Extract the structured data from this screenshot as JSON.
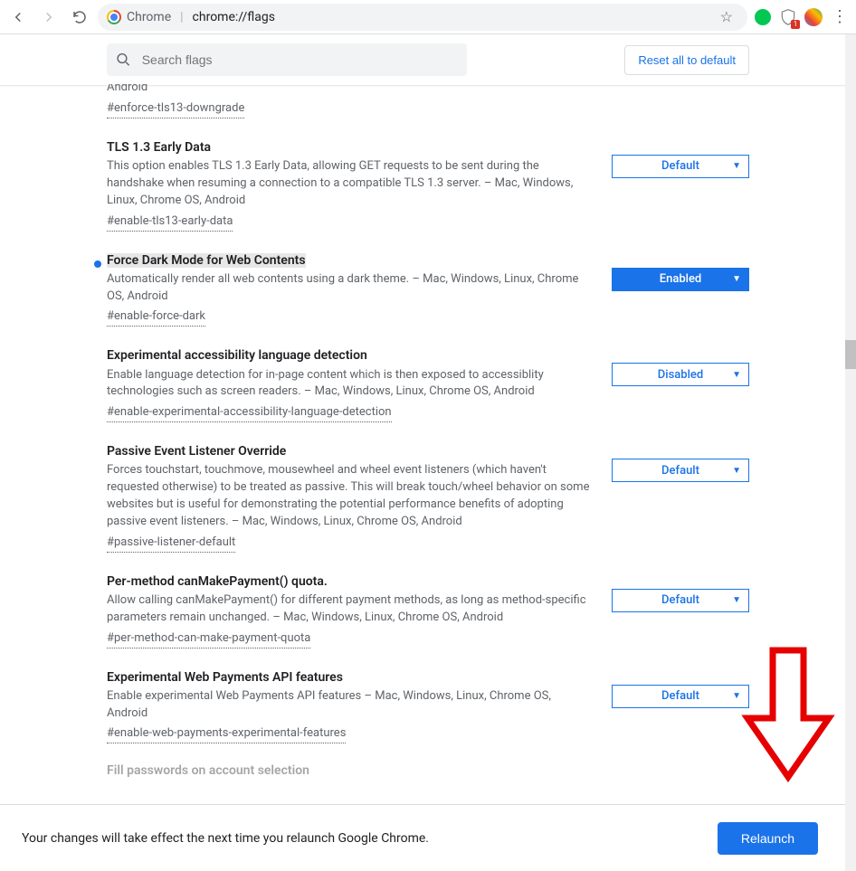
{
  "toolbar": {
    "omnibox_label": "Chrome",
    "omnibox_path": "chrome://flags",
    "ext_badge": "1"
  },
  "sticky": {
    "search_placeholder": "Search flags",
    "reset_label": "Reset all to default"
  },
  "cutoff_top": {
    "desc_fragment": "correctly or securely. They must be fixed by vendors. – Mac, Windows, Linux, Chrome OS, Android",
    "hash": "#enforce-tls13-downgrade"
  },
  "flags": [
    {
      "title": "TLS 1.3 Early Data",
      "desc": "This option enables TLS 1.3 Early Data, allowing GET requests to be sent during the handshake when resuming a connection to a compatible TLS 1.3 server. – Mac, Windows, Linux, Chrome OS, Android",
      "hash": "#enable-tls13-early-data",
      "select": "Default",
      "enabled": false,
      "dot": false,
      "highlight": false
    },
    {
      "title": "Force Dark Mode for Web Contents",
      "desc": "Automatically render all web contents using a dark theme. – Mac, Windows, Linux, Chrome OS, Android",
      "hash": "#enable-force-dark",
      "select": "Enabled",
      "enabled": true,
      "dot": true,
      "highlight": true
    },
    {
      "title": "Experimental accessibility language detection",
      "desc": "Enable language detection for in-page content which is then exposed to accessiblity technologies such as screen readers. – Mac, Windows, Linux, Chrome OS, Android",
      "hash": "#enable-experimental-accessibility-language-detection",
      "select": "Disabled",
      "enabled": false,
      "dot": false,
      "highlight": false
    },
    {
      "title": "Passive Event Listener Override",
      "desc": "Forces touchstart, touchmove, mousewheel and wheel event listeners (which haven't requested otherwise) to be treated as passive. This will break touch/wheel behavior on some websites but is useful for demonstrating the potential performance benefits of adopting passive event listeners. – Mac, Windows, Linux, Chrome OS, Android",
      "hash": "#passive-listener-default",
      "select": "Default",
      "enabled": false,
      "dot": false,
      "highlight": false
    },
    {
      "title": "Per-method canMakePayment() quota.",
      "desc": "Allow calling canMakePayment() for different payment methods, as long as method-specific parameters remain unchanged. – Mac, Windows, Linux, Chrome OS, Android",
      "hash": "#per-method-can-make-payment-quota",
      "select": "Default",
      "enabled": false,
      "dot": false,
      "highlight": false
    },
    {
      "title": "Experimental Web Payments API features",
      "desc": "Enable experimental Web Payments API features – Mac, Windows, Linux, Chrome OS, Android",
      "hash": "#enable-web-payments-experimental-features",
      "select": "Default",
      "enabled": false,
      "dot": false,
      "highlight": false
    }
  ],
  "cutoff_bottom_title": "Fill passwords on account selection",
  "bottombar": {
    "text": "Your changes will take effect the next time you relaunch Google Chrome.",
    "relaunch_label": "Relaunch"
  }
}
